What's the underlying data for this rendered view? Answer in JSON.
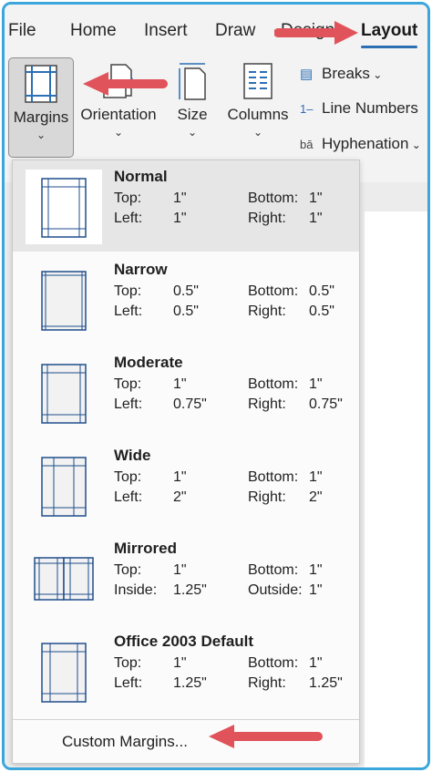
{
  "menu": {
    "tabs": [
      "File",
      "Home",
      "Insert",
      "Draw",
      "Design",
      "Layout"
    ],
    "active": "Layout"
  },
  "ribbon": {
    "margins": "Margins",
    "orientation": "Orientation",
    "size": "Size",
    "columns": "Columns",
    "breaks": "Breaks",
    "line_numbers": "Line Numbers",
    "hyphenation": "Hyphenation"
  },
  "icons": {
    "breaks": "breaks-icon",
    "line_numbers": "line-numbers-icon",
    "hyphenation": "hyphenation-icon",
    "chevron": "chevron-down-icon"
  },
  "margin_presets": [
    {
      "name": "Normal",
      "k1": "Top:",
      "v1": "1\"",
      "k2": "Bottom:",
      "v2": "1\"",
      "k3": "Left:",
      "v3": "1\"",
      "k4": "Right:",
      "v4": "1\""
    },
    {
      "name": "Narrow",
      "k1": "Top:",
      "v1": "0.5\"",
      "k2": "Bottom:",
      "v2": "0.5\"",
      "k3": "Left:",
      "v3": "0.5\"",
      "k4": "Right:",
      "v4": "0.5\""
    },
    {
      "name": "Moderate",
      "k1": "Top:",
      "v1": "1\"",
      "k2": "Bottom:",
      "v2": "1\"",
      "k3": "Left:",
      "v3": "0.75\"",
      "k4": "Right:",
      "v4": "0.75\""
    },
    {
      "name": "Wide",
      "k1": "Top:",
      "v1": "1\"",
      "k2": "Bottom:",
      "v2": "1\"",
      "k3": "Left:",
      "v3": "2\"",
      "k4": "Right:",
      "v4": "2\""
    },
    {
      "name": "Mirrored",
      "k1": "Top:",
      "v1": "1\"",
      "k2": "Bottom:",
      "v2": "1\"",
      "k3": "Inside:",
      "v3": "1.25\"",
      "k4": "Outside:",
      "v4": "1\""
    },
    {
      "name": "Office 2003 Default",
      "k1": "Top:",
      "v1": "1\"",
      "k2": "Bottom:",
      "v2": "1\"",
      "k3": "Left:",
      "v3": "1.25\"",
      "k4": "Right:",
      "v4": "1.25\""
    }
  ],
  "selected_preset": "Normal",
  "custom_margins": "Custom Margins...",
  "colors": {
    "accent": "#2b6fb4",
    "frame": "#3aa6dc",
    "arrow": "#e0535a",
    "thumb_line": "#1f4e8c"
  }
}
